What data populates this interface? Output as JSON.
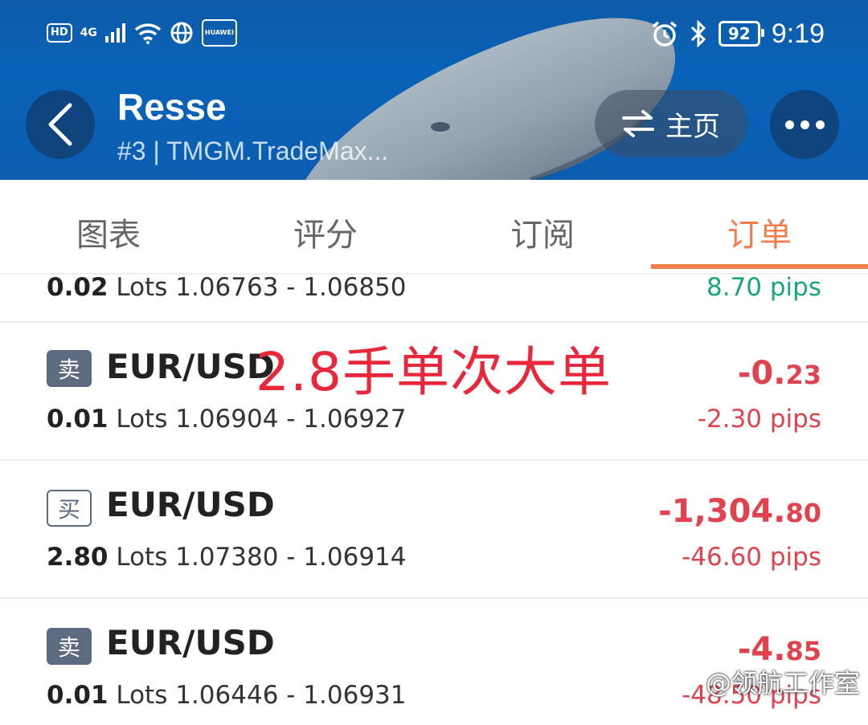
{
  "status_bar": {
    "left_items": [
      "HD",
      "4G"
    ],
    "vendor_chip": "HUAWEI",
    "battery": "92",
    "time": "9:19"
  },
  "header": {
    "title": "Resse",
    "subtitle": "#3 | TMGM.TradeMax...",
    "home_label": "主页"
  },
  "tabs": [
    {
      "label": "图表",
      "active": false
    },
    {
      "label": "评分",
      "active": false
    },
    {
      "label": "订阅",
      "active": false
    },
    {
      "label": "订单",
      "active": true
    }
  ],
  "annotation": "2.8手单次大单",
  "orders": [
    {
      "side": "",
      "pair": "",
      "lots_value": "0.02",
      "lots_unit": "Lots",
      "prices": "1.06763 - 1.06850",
      "pnl_int": "",
      "pnl_dec": "",
      "pips": "8.70 pips"
    },
    {
      "side": "卖",
      "pair": "EUR/USD",
      "lots_value": "0.01",
      "lots_unit": "Lots",
      "prices": "1.06904 - 1.06927",
      "pnl_int": "-0.",
      "pnl_dec": "23",
      "pips": "-2.30 pips"
    },
    {
      "side": "买",
      "pair": "EUR/USD",
      "lots_value": "2.80",
      "lots_unit": "Lots",
      "prices": "1.07380 - 1.06914",
      "pnl_int": "-1,304.",
      "pnl_dec": "80",
      "pips": "-46.60 pips"
    },
    {
      "side": "卖",
      "pair": "EUR/USD",
      "lots_value": "0.01",
      "lots_unit": "Lots",
      "prices": "1.06446 - 1.06931",
      "pnl_int": "-4.",
      "pnl_dec": "85",
      "pips": "-48.50 pips"
    }
  ],
  "watermark": "@领航工作室",
  "colors": {
    "accent": "#f07d4a",
    "loss": "#e0424e",
    "profit": "#1aa57a",
    "badge": "#5c6b7f"
  }
}
